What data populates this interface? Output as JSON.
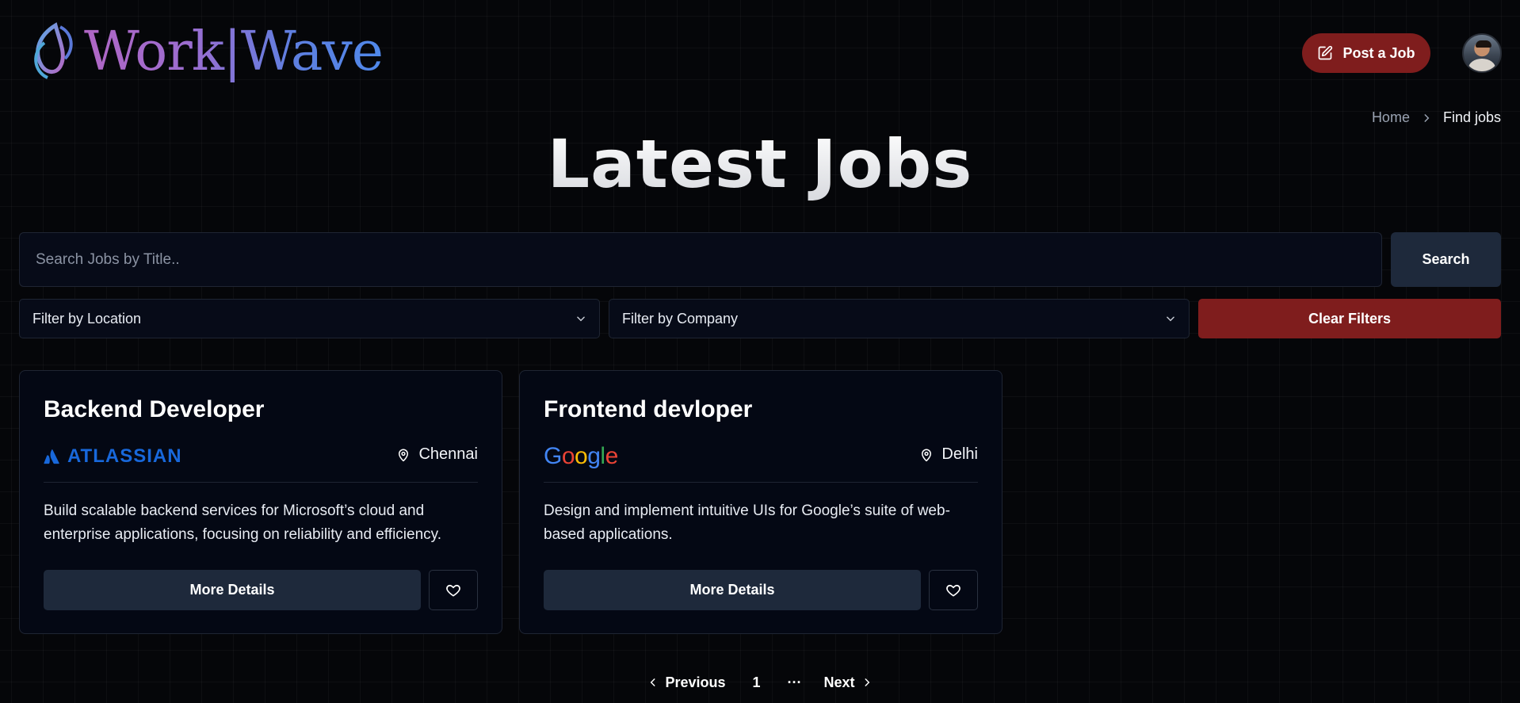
{
  "brand": {
    "name": "Work|Wave",
    "logo_icon": "workwave-logo-icon"
  },
  "header": {
    "post_job_label": "Post a Job",
    "post_job_icon": "edit-icon",
    "avatar_icon": "user-avatar"
  },
  "breadcrumb": {
    "home": "Home",
    "current": "Find jobs",
    "separator_icon": "chevron-right-icon"
  },
  "page": {
    "title": "Latest Jobs"
  },
  "search": {
    "placeholder": "Search Jobs by Title..",
    "value": "",
    "button_label": "Search"
  },
  "filters": {
    "location_label": "Filter by Location",
    "company_label": "Filter by Company",
    "clear_label": "Clear Filters"
  },
  "jobs": [
    {
      "title": "Backend Developer",
      "company": "ATLASSIAN",
      "location": "Chennai",
      "description": "Build scalable backend services for Microsoft’s cloud and enterprise applications, focusing on reliability and efficiency.",
      "details_label": "More Details"
    },
    {
      "title": "Frontend devloper",
      "company": "Google",
      "location": "Delhi",
      "description": "Design and implement intuitive UIs for Google’s suite of web-based applications.",
      "details_label": "More Details"
    }
  ],
  "pagination": {
    "previous": "Previous",
    "page": "1",
    "ellipsis": "···",
    "next": "Next"
  },
  "colors": {
    "accent_red": "#7f1d1d",
    "button_slate": "#1e293b",
    "background": "#050609",
    "atlassian_blue": "#1868db"
  }
}
